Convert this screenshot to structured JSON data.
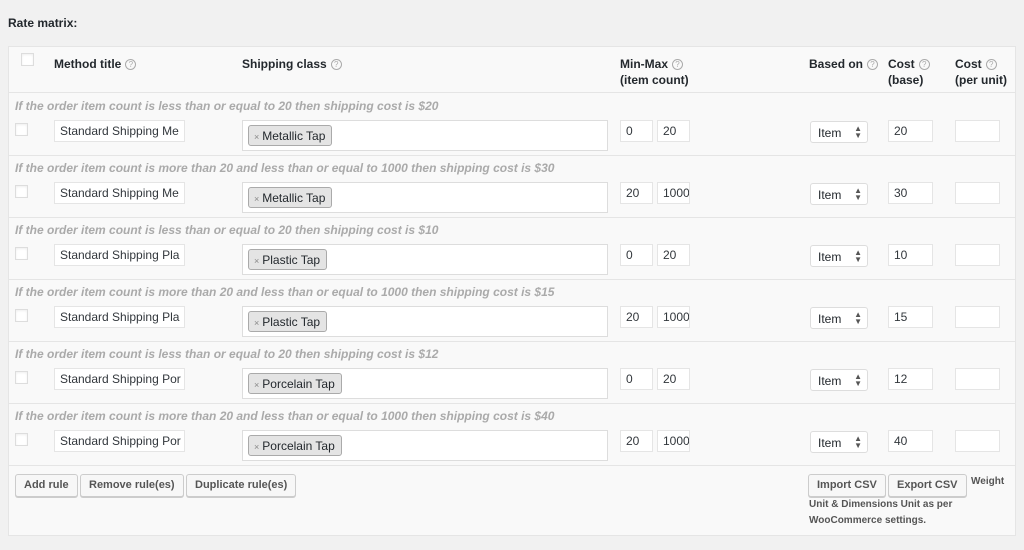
{
  "title": "Rate matrix:",
  "headers": {
    "method_title": "Method title",
    "shipping_class": "Shipping class",
    "minmax_1": "Min-Max",
    "minmax_2": "(item count)",
    "based_on": "Based on",
    "cost_base_1": "Cost",
    "cost_base_2": "(base)",
    "cost_unit_1": "Cost",
    "cost_unit_2": "(per unit)",
    "help": "?"
  },
  "rows": [
    {
      "desc": "If the order item count is less than or equal to 20 then shipping cost is $20",
      "method": "Standard Shipping Me",
      "class": "Metallic Tap",
      "min": "0",
      "max": "20",
      "based_on": "Item",
      "cost": "20",
      "per_unit": ""
    },
    {
      "desc": "If the order item count is more than 20 and less than or equal to 1000 then shipping cost is $30",
      "method": "Standard Shipping Me",
      "class": "Metallic Tap",
      "min": "20",
      "max": "1000",
      "based_on": "Item",
      "cost": "30",
      "per_unit": ""
    },
    {
      "desc": "If the order item count is less than or equal to 20 then shipping cost is $10",
      "method": "Standard Shipping Pla",
      "class": "Plastic Tap",
      "min": "0",
      "max": "20",
      "based_on": "Item",
      "cost": "10",
      "per_unit": ""
    },
    {
      "desc": "If the order item count is more than 20 and less than or equal to 1000 then shipping cost is $15",
      "method": "Standard Shipping Pla",
      "class": "Plastic Tap",
      "min": "20",
      "max": "1000",
      "based_on": "Item",
      "cost": "15",
      "per_unit": ""
    },
    {
      "desc": "If the order item count is less than or equal to 20 then shipping cost is $12",
      "method": "Standard Shipping Por",
      "class": "Porcelain Tap",
      "min": "0",
      "max": "20",
      "based_on": "Item",
      "cost": "12",
      "per_unit": ""
    },
    {
      "desc": "If the order item count is more than 20 and less than or equal to 1000 then shipping cost is $40",
      "method": "Standard Shipping Por",
      "class": "Porcelain Tap",
      "min": "20",
      "max": "1000",
      "based_on": "Item",
      "cost": "40",
      "per_unit": ""
    }
  ],
  "buttons": {
    "add": "Add rule",
    "remove": "Remove rule(es)",
    "duplicate": "Duplicate rule(es)",
    "import": "Import CSV",
    "export": "Export CSV"
  },
  "note_1": "Weight",
  "note_2": "Unit & Dimensions Unit as per",
  "note_3": "WooCommerce settings.",
  "remove_tag_glyph": "×"
}
